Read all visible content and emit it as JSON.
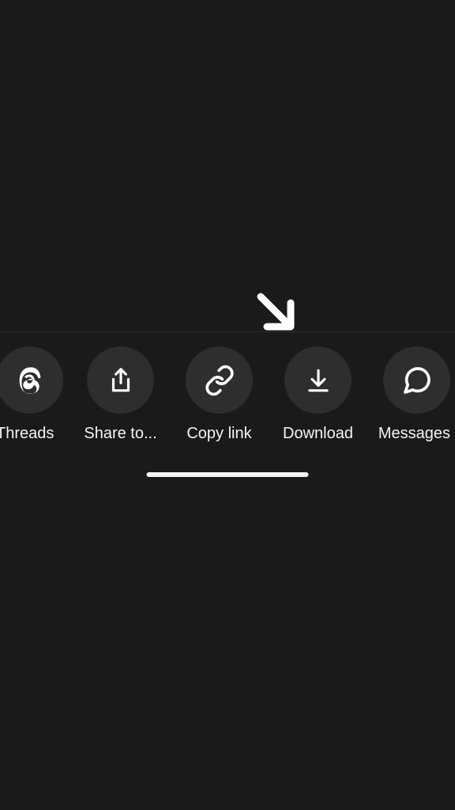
{
  "share_options": {
    "threads": {
      "label": "Threads"
    },
    "share_to": {
      "label": "Share to..."
    },
    "copy_link": {
      "label": "Copy link"
    },
    "download": {
      "label": "Download"
    },
    "messages": {
      "label": "Messages"
    }
  }
}
